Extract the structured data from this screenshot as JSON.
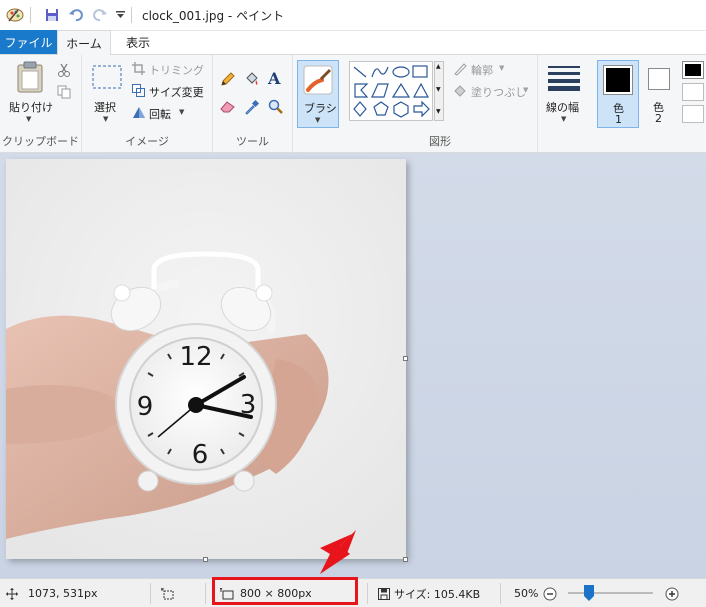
{
  "window": {
    "title": "clock_001.jpg - ペイント"
  },
  "tabs": {
    "file": "ファイル",
    "home": "ホーム",
    "view": "表示"
  },
  "ribbon": {
    "clipboard": {
      "paste": "貼り付け",
      "group": "クリップボード"
    },
    "image": {
      "select": "選択",
      "crop": "トリミング",
      "resize": "サイズ変更",
      "rotate": "回転",
      "group": "イメージ"
    },
    "tools": {
      "group": "ツール"
    },
    "brush": {
      "label": "ブラシ"
    },
    "shapes": {
      "outline": "輪郭",
      "fill": "塗りつぶし",
      "group": "図形"
    },
    "size": {
      "label": "線の幅"
    },
    "color1": {
      "label": "色",
      "num": "1"
    },
    "color2": {
      "label": "色",
      "num": "2"
    },
    "colors": {
      "color1": "#000000",
      "color2": "#ffffff",
      "accent": "#1979ca"
    }
  },
  "status": {
    "cursor_pos": "1073, 531px",
    "image_size": "800 × 800px",
    "file_size": "サイズ: 105.4KB",
    "zoom": "50%"
  },
  "icons": {
    "app": "paint-app-icon",
    "save": "save-icon",
    "undo": "undo-icon",
    "redo": "redo-icon",
    "cursor": "crosshair-icon",
    "selection": "selection-size-icon",
    "canvas": "canvas-size-icon",
    "disk": "disk-icon",
    "zoom_out": "zoom-out-icon",
    "zoom_in": "zoom-in-icon",
    "annotation": "red-arrow-icon"
  }
}
